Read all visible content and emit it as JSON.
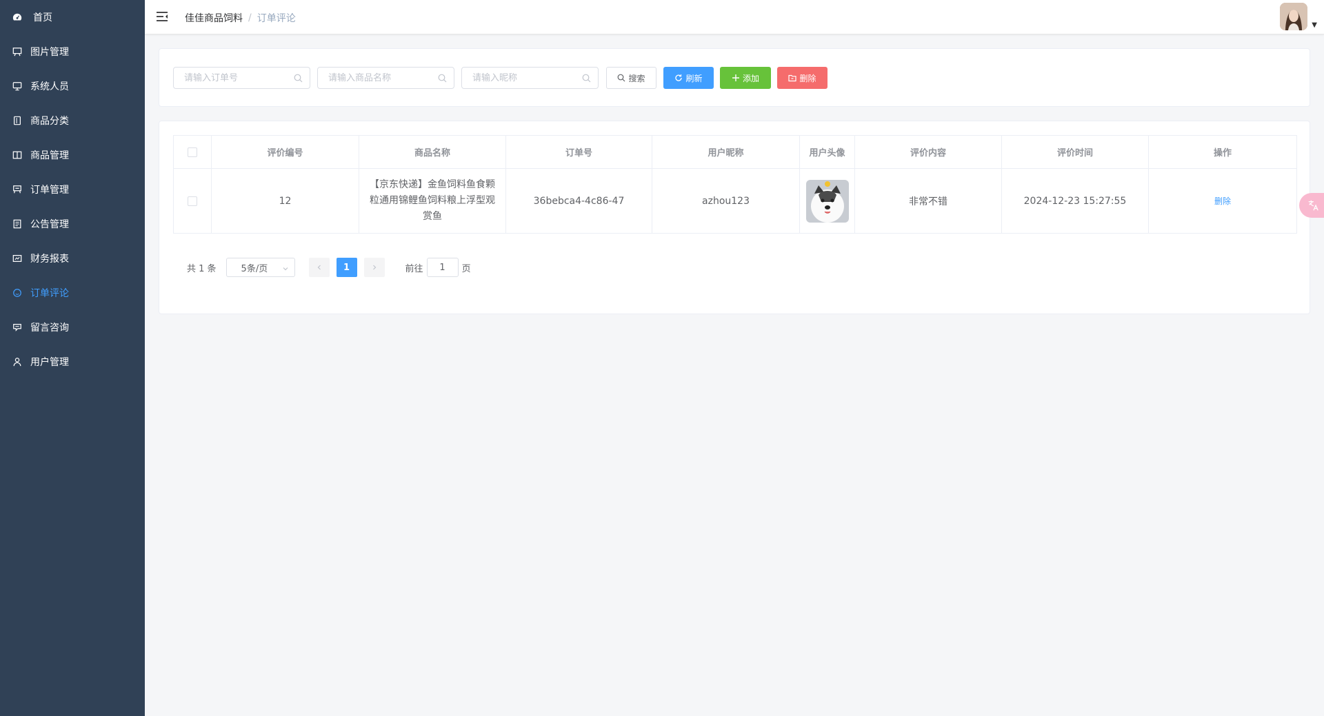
{
  "sidebar": {
    "items": [
      {
        "label": "首页",
        "icon": "dashboard-icon"
      },
      {
        "label": "图片管理",
        "icon": "image-icon"
      },
      {
        "label": "系统人员",
        "icon": "monitor-icon"
      },
      {
        "label": "商品分类",
        "icon": "tablet-icon"
      },
      {
        "label": "商品管理",
        "icon": "book-icon"
      },
      {
        "label": "订单管理",
        "icon": "cart-icon"
      },
      {
        "label": "公告管理",
        "icon": "document-icon"
      },
      {
        "label": "财务报表",
        "icon": "money-icon"
      },
      {
        "label": "订单评论",
        "icon": "chat-icon",
        "active": true
      },
      {
        "label": "留言咨询",
        "icon": "message-icon"
      },
      {
        "label": "用户管理",
        "icon": "user-icon"
      }
    ],
    "bg_color": "#304156",
    "active_color": "#409eff"
  },
  "header": {
    "breadcrumb": [
      "佳佳商品饲料",
      "订单评论"
    ],
    "separator": "/"
  },
  "search": {
    "order_placeholder": "请输入订单号",
    "product_placeholder": "请输入商品名称",
    "nickname_placeholder": "请输入昵称",
    "search_label": "搜索",
    "refresh_label": "刷新",
    "add_label": "添加",
    "delete_label": "删除"
  },
  "table": {
    "headers": [
      "评价编号",
      "商品名称",
      "订单号",
      "用户昵称",
      "用户头像",
      "评价内容",
      "评价时间",
      "操作"
    ],
    "rows": [
      {
        "id": "12",
        "product": "【京东快递】金鱼饲料鱼食颗粒通用锦鲤鱼饲料粮上浮型观赏鱼",
        "order_no": "36bebca4-4c86-47",
        "nickname": "azhou123",
        "content": "非常不错",
        "time": "2024-12-23 15:27:55",
        "action": "删除"
      }
    ]
  },
  "pagination": {
    "total": "共 1 条",
    "page_size": "5条/页",
    "current_page": "1",
    "goto_prefix": "前往",
    "goto_value": "1",
    "goto_suffix": "页"
  }
}
